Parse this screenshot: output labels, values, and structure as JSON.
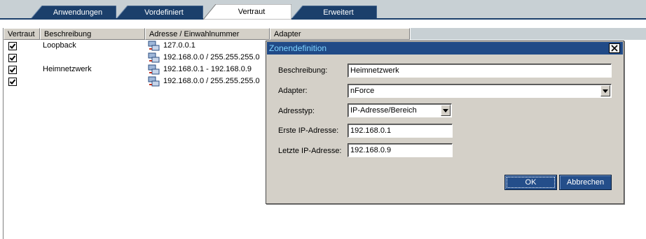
{
  "tabs": [
    {
      "label": "Anwendungen",
      "active": false
    },
    {
      "label": "Vordefiniert",
      "active": false
    },
    {
      "label": "Vertraut",
      "active": true
    },
    {
      "label": "Erweitert",
      "active": false
    }
  ],
  "table": {
    "headers": [
      "Vertraut",
      "Beschreibung",
      "Adresse / Einwahlnummer",
      "Adapter"
    ],
    "rows": [
      {
        "checked": true,
        "description": "Loopback",
        "address": "127.0.0.1"
      },
      {
        "checked": true,
        "description": "",
        "address": "192.168.0.0 / 255.255.255.0"
      },
      {
        "checked": true,
        "description": "Heimnetzwerk",
        "address": "192.168.0.1 - 192.168.0.9"
      },
      {
        "checked": true,
        "description": "",
        "address": "192.168.0.0 / 255.255.255.0"
      }
    ]
  },
  "dialog": {
    "title": "Zonendefinition",
    "fields": {
      "beschreibung": {
        "label": "Beschreibung:",
        "value": "Heimnetzwerk"
      },
      "adapter": {
        "label": "Adapter:",
        "value": "nForce"
      },
      "adresstyp": {
        "label": "Adresstyp:",
        "value": "IP-Adresse/Bereich"
      },
      "erste": {
        "label": "Erste IP-Adresse:",
        "value": "192.168.0.1"
      },
      "letzte": {
        "label": "Letzte IP-Adresse:",
        "value": "192.168.0.9"
      }
    },
    "ok_label": "OK",
    "cancel_label": "Abbrechen"
  },
  "icons": {
    "row_icon": "network-address-icon",
    "check_icon": "checkmark-icon",
    "close_icon": "close-icon",
    "dropdown_icon": "chevron-down-icon"
  },
  "colors": {
    "tab_dark": "#1b3f6b",
    "title_bar": "#204a87",
    "button": "#244e8a"
  }
}
